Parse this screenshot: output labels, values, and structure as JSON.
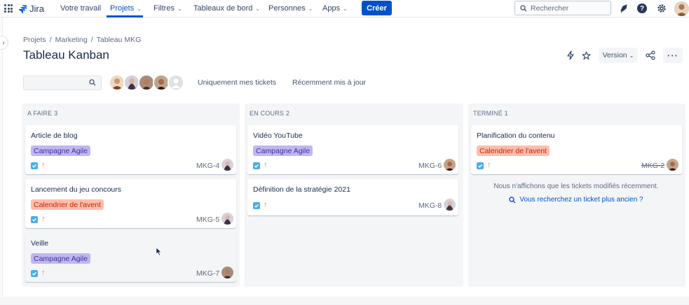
{
  "nav": {
    "logo": "Jira",
    "items": [
      "Votre travail",
      "Projets",
      "Filtres",
      "Tableaux de bord",
      "Personnes",
      "Apps"
    ],
    "create": "Créer",
    "search_placeholder": "Rechercher"
  },
  "breadcrumb": [
    "Projets",
    "Marketing",
    "Tableau MKG"
  ],
  "breadcrumb_sep": "/",
  "title": "Tableau Kanban",
  "version_label": "Version",
  "filters": {
    "only_mine": "Uniquement mes tickets",
    "recent": "Récemment mis à jour"
  },
  "columns": [
    {
      "name": "A FAIRE",
      "count": "3",
      "cards": [
        {
          "title": "Article de blog",
          "epic": "Campagne Agile",
          "epic_color": "purple",
          "key": "MKG-4"
        },
        {
          "title": "Lancement du jeu concours",
          "epic": "Calendrier de l'avent",
          "epic_color": "orange",
          "key": "MKG-5"
        },
        {
          "title": "Veille",
          "epic": "Campagne Agile",
          "epic_color": "purple",
          "key": "MKG-7"
        }
      ]
    },
    {
      "name": "EN COURS",
      "count": "2",
      "cards": [
        {
          "title": "Vidéo YouTube",
          "epic": "Campagne Agile",
          "epic_color": "purple",
          "key": "MKG-6"
        },
        {
          "title": "Définition de la stratégie 2021",
          "epic": "",
          "epic_color": "",
          "key": "MKG-8"
        }
      ]
    },
    {
      "name": "TERMINÉ",
      "count": "1",
      "cards": [
        {
          "title": "Planification du contenu",
          "epic": "Calendrier de l'avent",
          "epic_color": "orange",
          "key": "MKG-2"
        }
      ],
      "note": "Nous n'affichons que les tickets modifiés récemment.",
      "link": "Vous recherchez un ticket plus ancien ?"
    }
  ],
  "colors": {
    "brand": "#0052cc",
    "epic_purple_bg": "#c0b6f2",
    "epic_orange_bg": "#ffbdad",
    "column_bg": "#f4f5f7",
    "priority": "#ff7452",
    "task": "#4bade8"
  },
  "icons": [
    "app-switcher-icon",
    "search-icon",
    "notification-icon",
    "help-icon",
    "settings-icon",
    "lightning-icon",
    "star-icon",
    "share-icon",
    "more-icon",
    "chevron-down-icon",
    "checkbox-task-icon",
    "priority-high-icon"
  ]
}
